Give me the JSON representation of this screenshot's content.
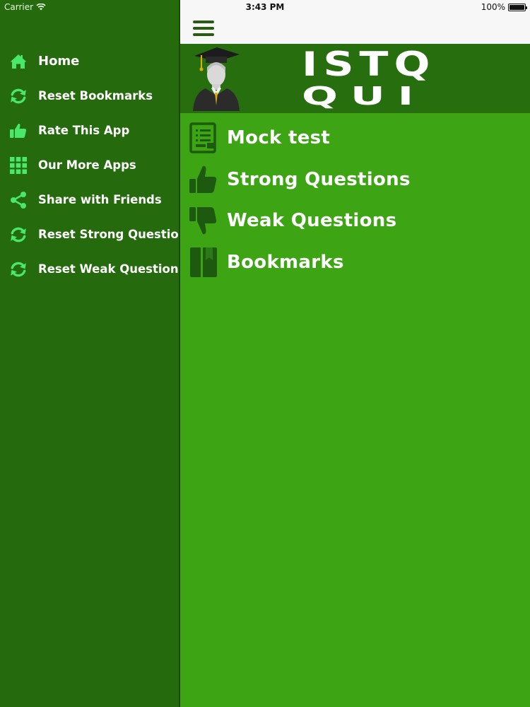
{
  "status_bar": {
    "carrier": "Carrier",
    "time": "3:43 PM",
    "battery": "100%",
    "battery_level": 1.0
  },
  "drawer": {
    "items": [
      {
        "label": "Home",
        "icon": "home-icon"
      },
      {
        "label": "Reset Bookmarks",
        "icon": "refresh-icon"
      },
      {
        "label": "Rate This App",
        "icon": "thumbs-up-icon"
      },
      {
        "label": "Our More Apps",
        "icon": "grid-icon"
      },
      {
        "label": "Share with Friends",
        "icon": "share-icon"
      },
      {
        "label": "Reset Strong Questions",
        "icon": "refresh-icon"
      },
      {
        "label": "Reset Weak Questions",
        "icon": "refresh-icon"
      }
    ]
  },
  "header": {
    "menu_icon": "hamburger-icon"
  },
  "banner": {
    "line1": "ISTQ",
    "line2": "QUI",
    "avatar_icon": "graduate-avatar-icon"
  },
  "main": {
    "options": [
      {
        "label": "Mock test",
        "icon": "notes-icon"
      },
      {
        "label": "Strong Questions",
        "icon": "thumbs-up-icon"
      },
      {
        "label": "Weak Questions",
        "icon": "thumbs-down-icon"
      },
      {
        "label": "Bookmarks",
        "icon": "book-icon"
      }
    ]
  },
  "colors": {
    "drawer_bg": "#256b0e",
    "main_bg": "#3da513",
    "banner_bg": "#276e0e",
    "nav_bg": "#f7f7f7",
    "drawer_icon": "#49e86a",
    "option_icon": "#1d5a10"
  }
}
